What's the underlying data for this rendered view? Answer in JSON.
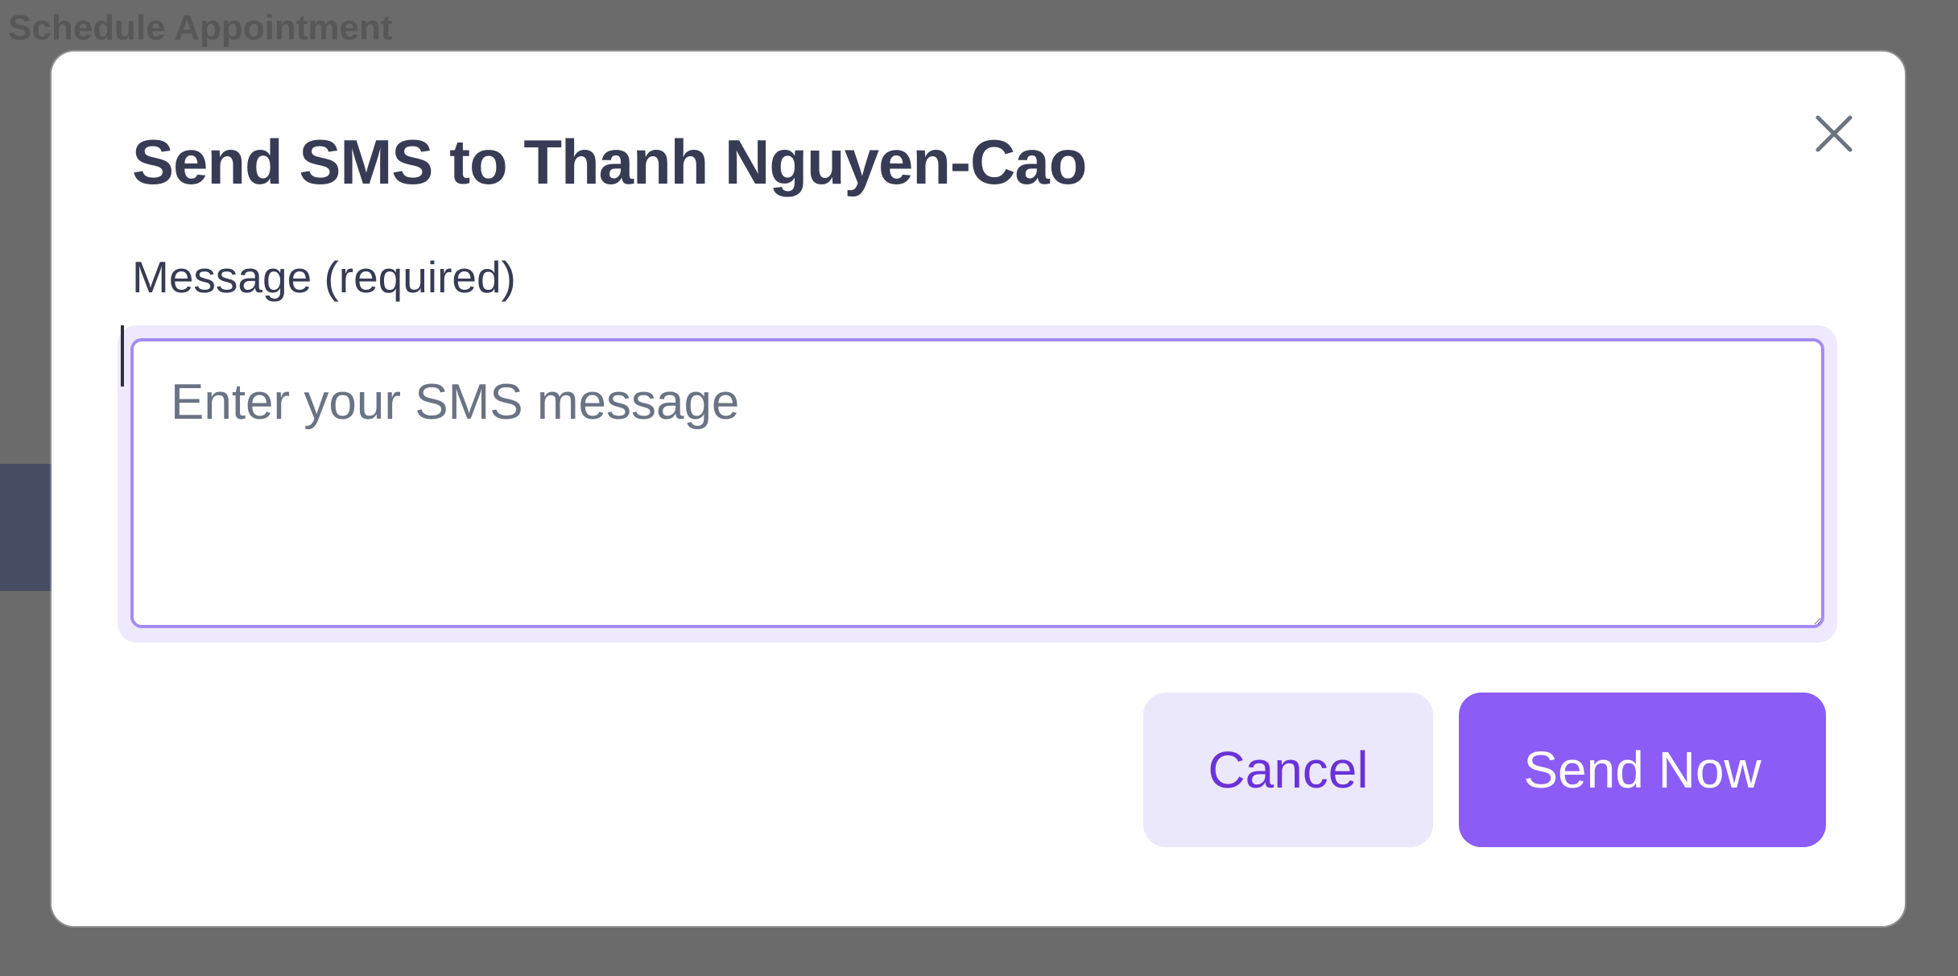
{
  "background": {
    "header_fragment": "Schedule Appointment"
  },
  "modal": {
    "title": "Send SMS to Thanh Nguyen-Cao",
    "close_icon": "close-icon",
    "message_label": "Message (required)",
    "message_value": "",
    "message_placeholder": "Enter your SMS message",
    "cancel_label": "Cancel",
    "send_label": "Send Now"
  },
  "colors": {
    "overlay": "#6a6a6a",
    "title_text": "#373b54",
    "focus_ring": "#eee9fd",
    "input_border": "#a48cf2",
    "primary": "#8b5cf6",
    "secondary_bg": "#ece8fc",
    "secondary_text": "#6a32d8"
  }
}
